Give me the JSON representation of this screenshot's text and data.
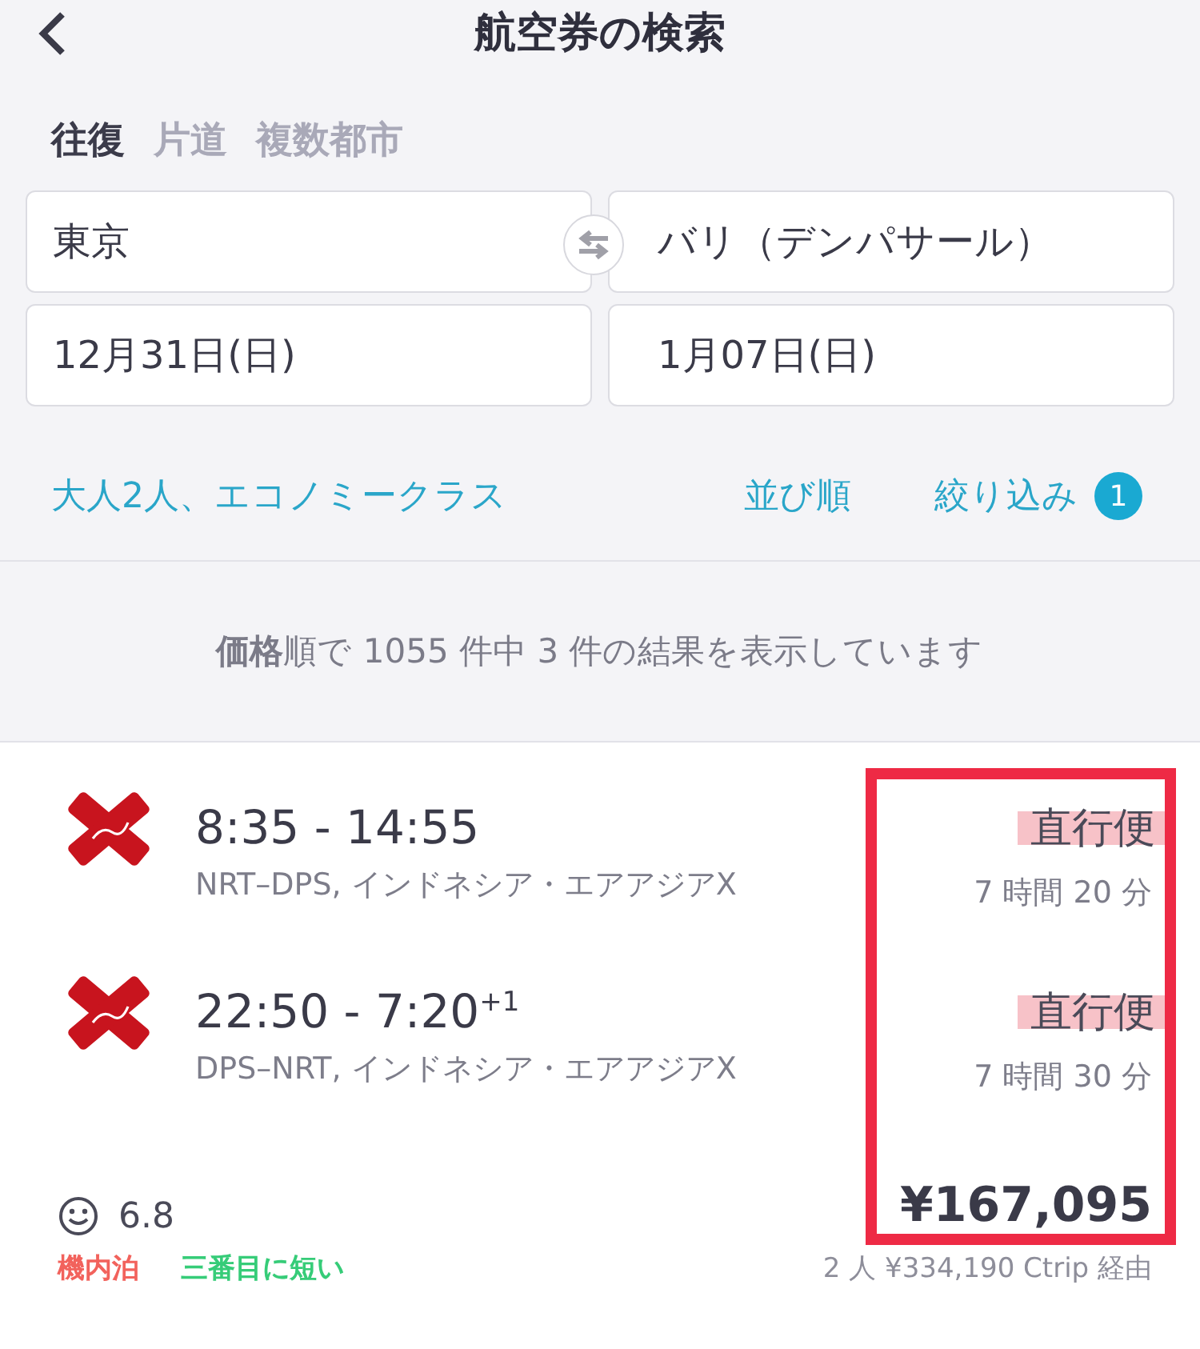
{
  "header": {
    "title": "航空券の検索"
  },
  "trip_types": [
    {
      "label": "往復",
      "selected": true
    },
    {
      "label": "片道",
      "selected": false
    },
    {
      "label": "複数都市",
      "selected": false
    }
  ],
  "origin": {
    "value": "東京"
  },
  "destination": {
    "value": "バリ（デンパサール）"
  },
  "depart_date": {
    "value": "12月31日(日)"
  },
  "return_date": {
    "value": "1月07日(日)"
  },
  "options": {
    "passengers": "大人2人、エコノミークラス",
    "sort": "並び順",
    "filter": "絞り込み",
    "filter_count": "1"
  },
  "summary": "**価格**順で 1055 件中 3 件の結果を表示しています",
  "result": {
    "flights": [
      {
        "times": "8:35 - 14:55",
        "route": "NRT–DPS, インドネシア・エアアジアX",
        "stops": "直行便",
        "duration": "7 時間 20 分"
      },
      {
        "times": "22:50 - 7:20$^{+1}$",
        "route": "DPS–NRT, インドネシア・エアアジアX",
        "stops": "直行便",
        "duration": "7 時間 30 分"
      }
    ],
    "rating": "6.8",
    "tags": [
      {
        "label": "機内泊",
        "color": "#f2625c"
      },
      {
        "label": "三番目に短い",
        "color": "#36cc78"
      }
    ],
    "price": "¥167,095",
    "total_note": "2 人 ¥334,190 Ctrip 経由"
  }
}
